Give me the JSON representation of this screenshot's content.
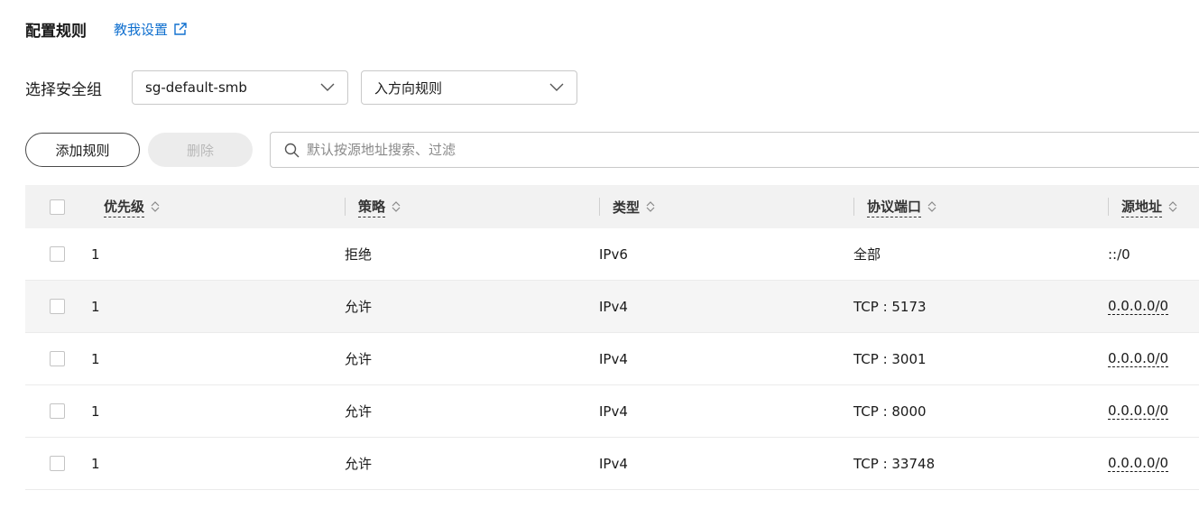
{
  "header": {
    "title": "配置规则",
    "help_link": "教我设置"
  },
  "security_group": {
    "label": "选择安全组",
    "selected_group": "sg-default-smb",
    "selected_direction": "入方向规则"
  },
  "toolbar": {
    "add_label": "添加规则",
    "delete_label": "删除",
    "search_placeholder": "默认按源地址搜索、过滤"
  },
  "table": {
    "columns": [
      "优先级",
      "策略",
      "类型",
      "协议端口",
      "源地址"
    ],
    "rows": [
      {
        "priority": "1",
        "policy": "拒绝",
        "type": "IPv6",
        "port": "全部",
        "source": "::/0"
      },
      {
        "priority": "1",
        "policy": "允许",
        "type": "IPv4",
        "port": "TCP : 5173",
        "source": "0.0.0.0/0"
      },
      {
        "priority": "1",
        "policy": "允许",
        "type": "IPv4",
        "port": "TCP : 3001",
        "source": "0.0.0.0/0"
      },
      {
        "priority": "1",
        "policy": "允许",
        "type": "IPv4",
        "port": "TCP : 8000",
        "source": "0.0.0.0/0"
      },
      {
        "priority": "1",
        "policy": "允许",
        "type": "IPv4",
        "port": "TCP : 33748",
        "source": "0.0.0.0/0"
      }
    ]
  },
  "colors": {
    "link": "#1170cf",
    "header_bg": "#f2f2f2",
    "alt_row_bg": "#f5f5f5"
  },
  "icons": {
    "external": "external-link-icon",
    "chevron": "chevron-down-icon",
    "search": "search-icon",
    "sort": "sort-icon"
  }
}
